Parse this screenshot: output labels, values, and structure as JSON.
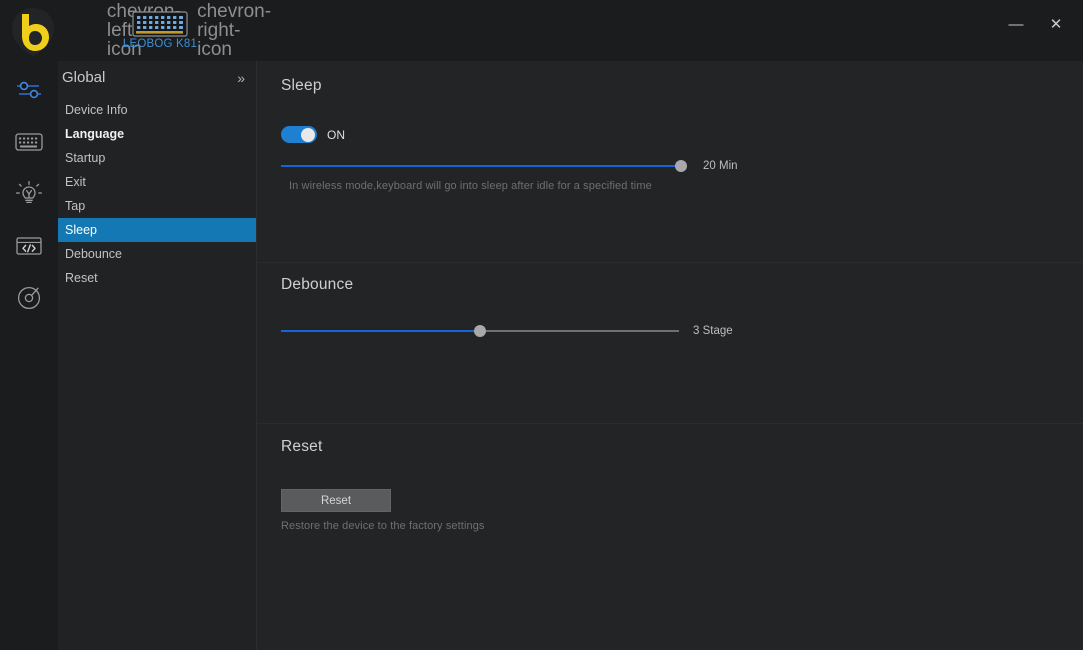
{
  "titlebar": {
    "logo_icon": "leobog-shield-b-logo",
    "prev_icon": "chevron-left-icon",
    "next_icon": "chevron-right-icon",
    "device_icon": "keyboard-icon",
    "device_name": "LEOBOG K81",
    "minimize_label": "—",
    "close_label": "✕"
  },
  "rail": {
    "items": [
      {
        "icon": "sliders-settings-icon",
        "active": true
      },
      {
        "icon": "keyboard-icon",
        "active": false
      },
      {
        "icon": "lightbulb-icon",
        "active": false
      },
      {
        "icon": "code-brackets-icon",
        "active": false
      },
      {
        "icon": "target-radar-icon",
        "active": false
      }
    ]
  },
  "menu": {
    "title": "Global",
    "collapse_icon": "double-chevron-right-icon",
    "items": [
      {
        "label": "Device Info",
        "state": "normal"
      },
      {
        "label": "Language",
        "state": "bold"
      },
      {
        "label": "Startup",
        "state": "normal"
      },
      {
        "label": "Exit",
        "state": "normal"
      },
      {
        "label": "Tap",
        "state": "normal"
      },
      {
        "label": "Sleep",
        "state": "active"
      },
      {
        "label": "Debounce",
        "state": "normal"
      },
      {
        "label": "Reset",
        "state": "normal"
      }
    ]
  },
  "sleep": {
    "title": "Sleep",
    "toggle_state": "ON",
    "toggle_on": true,
    "slider_value": "20 Min",
    "slider_percent": 100,
    "hint": "In wireless mode,keyboard will go into sleep after idle for a specified time"
  },
  "debounce": {
    "title": "Debounce",
    "slider_value": "3 Stage",
    "slider_percent": 50
  },
  "reset": {
    "title": "Reset",
    "button_label": "Reset",
    "hint": "Restore the device to the factory settings"
  },
  "colors": {
    "accent_blue": "#1478b4",
    "slider_blue": "#1763d8",
    "toggle_blue": "#1f7fd0",
    "logo_yellow": "#f0cf1b",
    "device_blue": "#3e8fd6"
  }
}
